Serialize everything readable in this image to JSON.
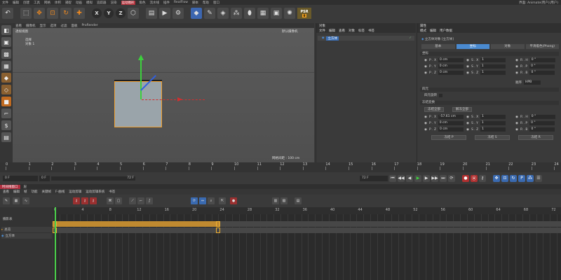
{
  "menubar": {
    "items": [
      "文件",
      "编辑",
      "创建",
      "工具",
      "网格",
      "体积",
      "捕捉",
      "动画",
      "模拟",
      "追踪器",
      "渲染",
      "运动图形",
      "角色",
      "流水线",
      "插件",
      "RealFlow",
      "脚本",
      "帮助",
      "窗口"
    ],
    "active": "运动图形",
    "right_label": "界面: Animate(用户)(用户)"
  },
  "toolbar": {
    "icons": [
      "undo-icon",
      "select-live-icon",
      "move-icon",
      "scale-icon",
      "rotate-icon",
      "add-icon",
      "x-axis-icon",
      "y-axis-icon",
      "z-axis-icon",
      "coordinate-icon",
      "render-region-icon",
      "render-view-icon",
      "render-settings-icon",
      "cube-icon",
      "pen-icon",
      "subdivision-icon",
      "array-icon",
      "deformer-icon",
      "scene-icon",
      "camera-icon",
      "light-icon"
    ],
    "axis_labels": [
      "X",
      "Y",
      "Z"
    ],
    "psr_label": "PSR",
    "psr_sub": "0"
  },
  "viewport": {
    "menu": [
      "查看",
      "摄像机",
      "显示",
      "选项",
      "过滤",
      "面板",
      "ProRender"
    ],
    "view_name": "透视视图",
    "hud_line1": "选择",
    "hud_line2": "对象  1",
    "camera_label": "默认摄像机",
    "grid_label": "网格间距 : 100 cm"
  },
  "objects": {
    "panel_title": "对象",
    "menu": [
      "文件",
      "编辑",
      "查看",
      "对象",
      "标签",
      "书签"
    ],
    "items": [
      {
        "name": "立方体"
      }
    ]
  },
  "attributes": {
    "panel_title": "属性",
    "menu": [
      "模式",
      "编辑",
      "用户数据"
    ],
    "object_title": "立方体对象 [立方体]",
    "tabs": [
      "基本",
      "坐标",
      "对象",
      "平滑着色(Phong)"
    ],
    "active_tab": "坐标",
    "section_coords": "坐标",
    "pos": [
      {
        "label": "P . X",
        "value": "0 cm"
      },
      {
        "label": "P . Y",
        "value": "0 cm"
      },
      {
        "label": "P . Z",
        "value": "0 cm"
      }
    ],
    "scale": [
      {
        "label": "S . X",
        "value": "1"
      },
      {
        "label": "S . Y",
        "value": "1"
      },
      {
        "label": "S . Z",
        "value": "1"
      }
    ],
    "rot": [
      {
        "label": "R . H",
        "value": "0 °"
      },
      {
        "label": "R . P",
        "value": "0 °"
      },
      {
        "label": "R . B",
        "value": "0 °"
      }
    ],
    "order_label": "顺序",
    "order_value": "HPB",
    "section_quat": "四元",
    "quat_label": "四元旋转",
    "section_freeze": "冻结变换",
    "freeze_all": "冻结全部",
    "unfreeze_all": "解冻全部",
    "freeze_pos": [
      {
        "label": "P . X",
        "value": "-57.61 cm"
      },
      {
        "label": "P . Y",
        "value": "0 cm"
      },
      {
        "label": "P . Z",
        "value": "0 cm"
      }
    ],
    "freeze_scale": [
      {
        "label": "S . X",
        "value": "1"
      },
      {
        "label": "S . Y",
        "value": "1"
      },
      {
        "label": "S . Z",
        "value": "1"
      }
    ],
    "freeze_rot": [
      {
        "label": "R . H",
        "value": "0 °"
      },
      {
        "label": "R . P",
        "value": "0 °"
      },
      {
        "label": "R . B",
        "value": "0 °"
      }
    ],
    "freeze_buttons": [
      "冻结 P",
      "冻结 S",
      "冻结 R"
    ]
  },
  "ruler": {
    "ticks": [
      "0",
      "1",
      "2",
      "3",
      "4",
      "5",
      "6",
      "7",
      "8",
      "9",
      "10",
      "11",
      "12",
      "13",
      "14",
      "15",
      "16",
      "17",
      "18",
      "19",
      "20",
      "21",
      "22",
      "23",
      "24"
    ]
  },
  "playback": {
    "current_frame": "0 F",
    "start_frame": "0 F",
    "end_frame": "72 F",
    "preview_end": "72 F",
    "end_label": "F"
  },
  "timeline": {
    "tabs": [
      "时间线窗口",
      "层"
    ],
    "menu": [
      "查看",
      "编辑",
      "帧",
      "功能",
      "关键帧",
      "F-曲线",
      "运动剪辑",
      "运动剪辑系统",
      "书签"
    ],
    "ruler_ticks": [
      "0",
      "4",
      "8",
      "12",
      "16",
      "20",
      "24",
      "28",
      "32",
      "36",
      "40",
      "44",
      "48",
      "52",
      "56",
      "60",
      "64",
      "68",
      "72"
    ],
    "left_header": "摄影表",
    "tracks": [
      {
        "name": "总览"
      },
      {
        "name": "立方体"
      }
    ]
  },
  "colors": {
    "accent": "#4a8ad0",
    "menu_active": "#b3303a",
    "key": "#f0b030",
    "playhead": "#4ad04a"
  }
}
